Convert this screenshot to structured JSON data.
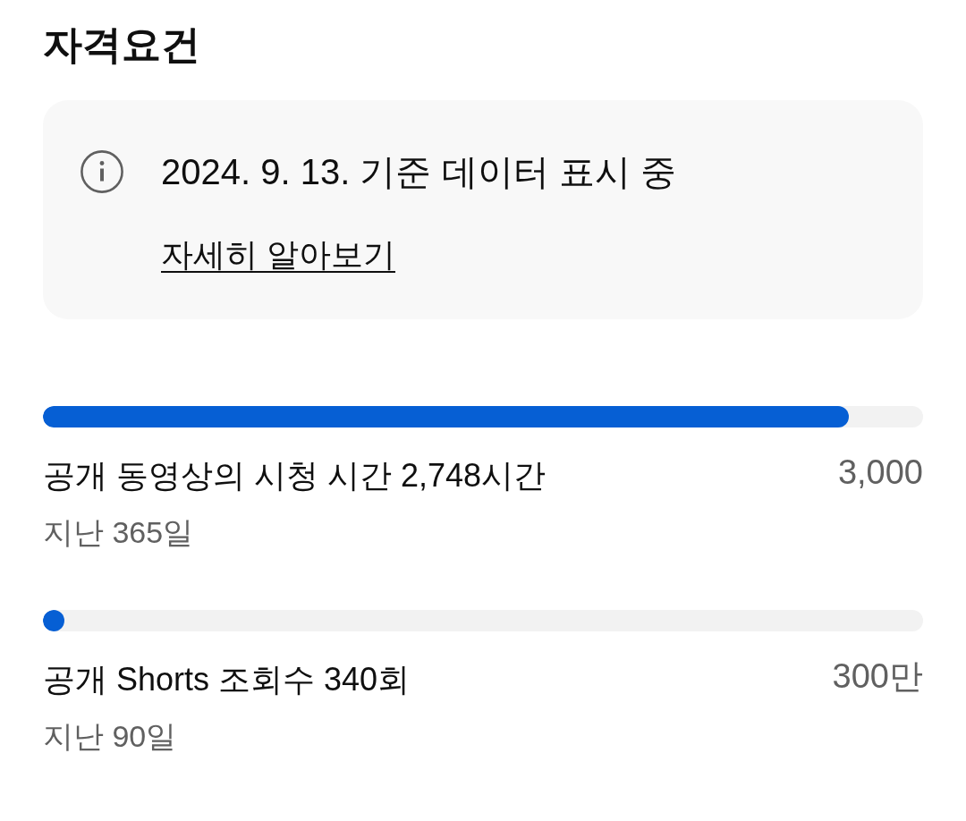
{
  "title": "자격요건",
  "notice": {
    "text": "2024. 9. 13. 기준 데이터 표시 중",
    "link": "자세히 알아보기"
  },
  "requirements": [
    {
      "label": "공개 동영상의 시청 시간 2,748시간",
      "period": "지난 365일",
      "target": "3,000",
      "level": 0.916
    },
    {
      "label": "공개 Shorts 조회수 340회",
      "period": "지난 90일",
      "target": "300만",
      "level": 0.0001
    }
  ]
}
